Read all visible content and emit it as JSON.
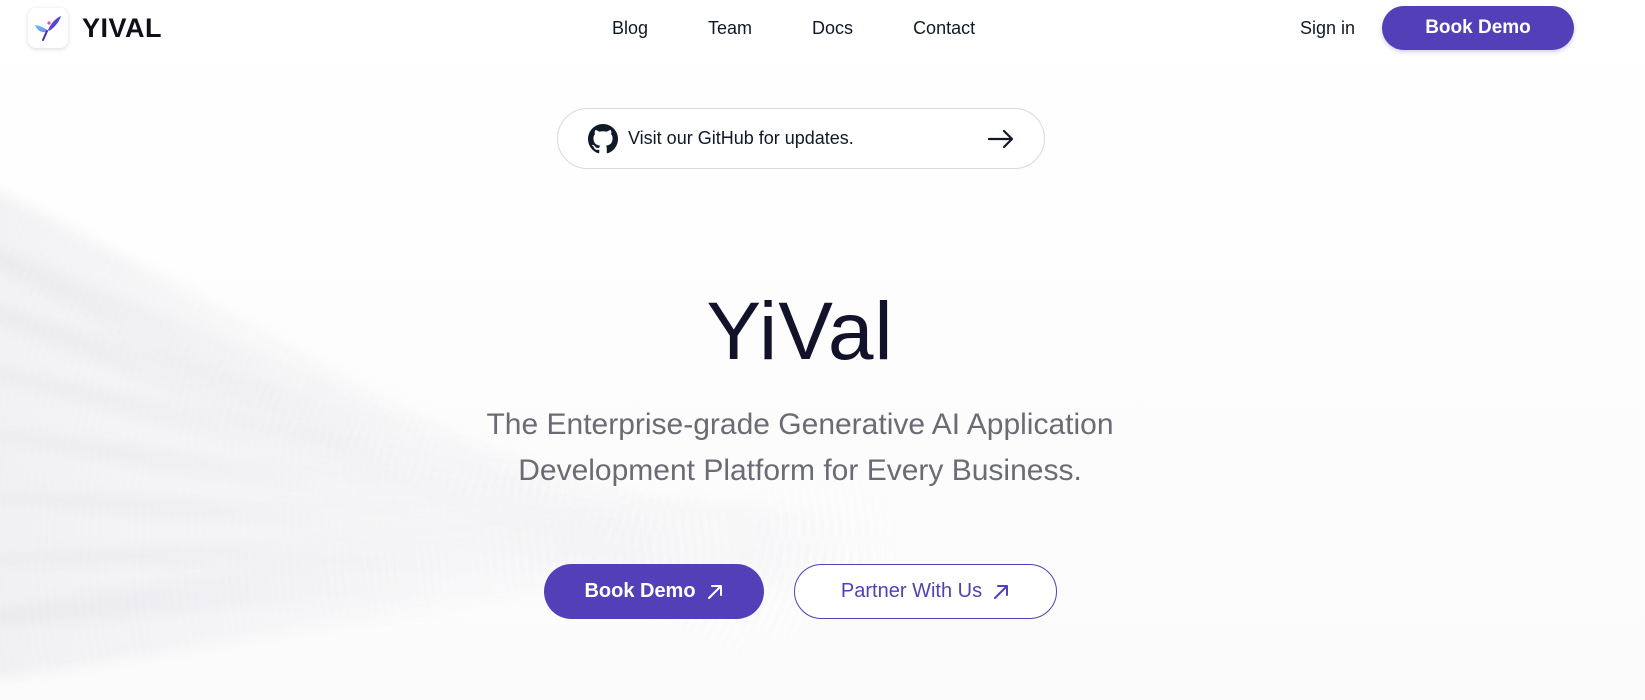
{
  "header": {
    "logo_text": "YIVAL",
    "nav": [
      {
        "label": "Blog"
      },
      {
        "label": "Team"
      },
      {
        "label": "Docs"
      },
      {
        "label": "Contact"
      }
    ],
    "sign_in_label": "Sign in",
    "book_demo_label": "Book Demo"
  },
  "announcement": {
    "icon": "github-icon",
    "text": "Visit our GitHub for updates.",
    "arrow_icon": "arrow-right-icon"
  },
  "hero": {
    "title": "YiVal",
    "subtitle_line1": "The Enterprise-grade Generative AI Application",
    "subtitle_line2": "Development Platform for Every Business.",
    "primary_cta_label": "Book Demo",
    "secondary_cta_label": "Partner With Us",
    "cta_icon": "arrow-up-right-icon"
  },
  "colors": {
    "accent": "#5340b8",
    "title": "#12122a",
    "subtitle": "#6b6b75",
    "border": "#d9d9de"
  }
}
